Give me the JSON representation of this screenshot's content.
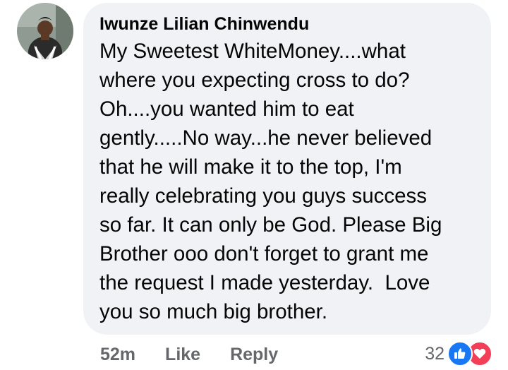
{
  "comment": {
    "author": "Iwunze Lilian Chinwendu",
    "text_lines": [
      "My Sweetest WhiteMoney....what",
      "where you expecting cross to do?",
      "Oh....you wanted him to eat",
      "gently.....No way...he never believed",
      "that he will make it to the top, I'm",
      "really celebrating you guys success",
      "so far. It can only be God. Please Big",
      "Brother ooo don't forget to grant me",
      "the request I made yesterday.  Love",
      "you so much big brother."
    ]
  },
  "actions": {
    "timestamp": "52m",
    "like_label": "Like",
    "reply_label": "Reply"
  },
  "reactions": {
    "count": "32",
    "icons": [
      "thumbs-up-icon",
      "heart-icon"
    ],
    "colors": {
      "like": "#1877f2",
      "love": "#f33e58"
    }
  },
  "colors": {
    "bubble_bg": "#f0f2f5",
    "text": "#050505",
    "meta": "#65676b"
  }
}
